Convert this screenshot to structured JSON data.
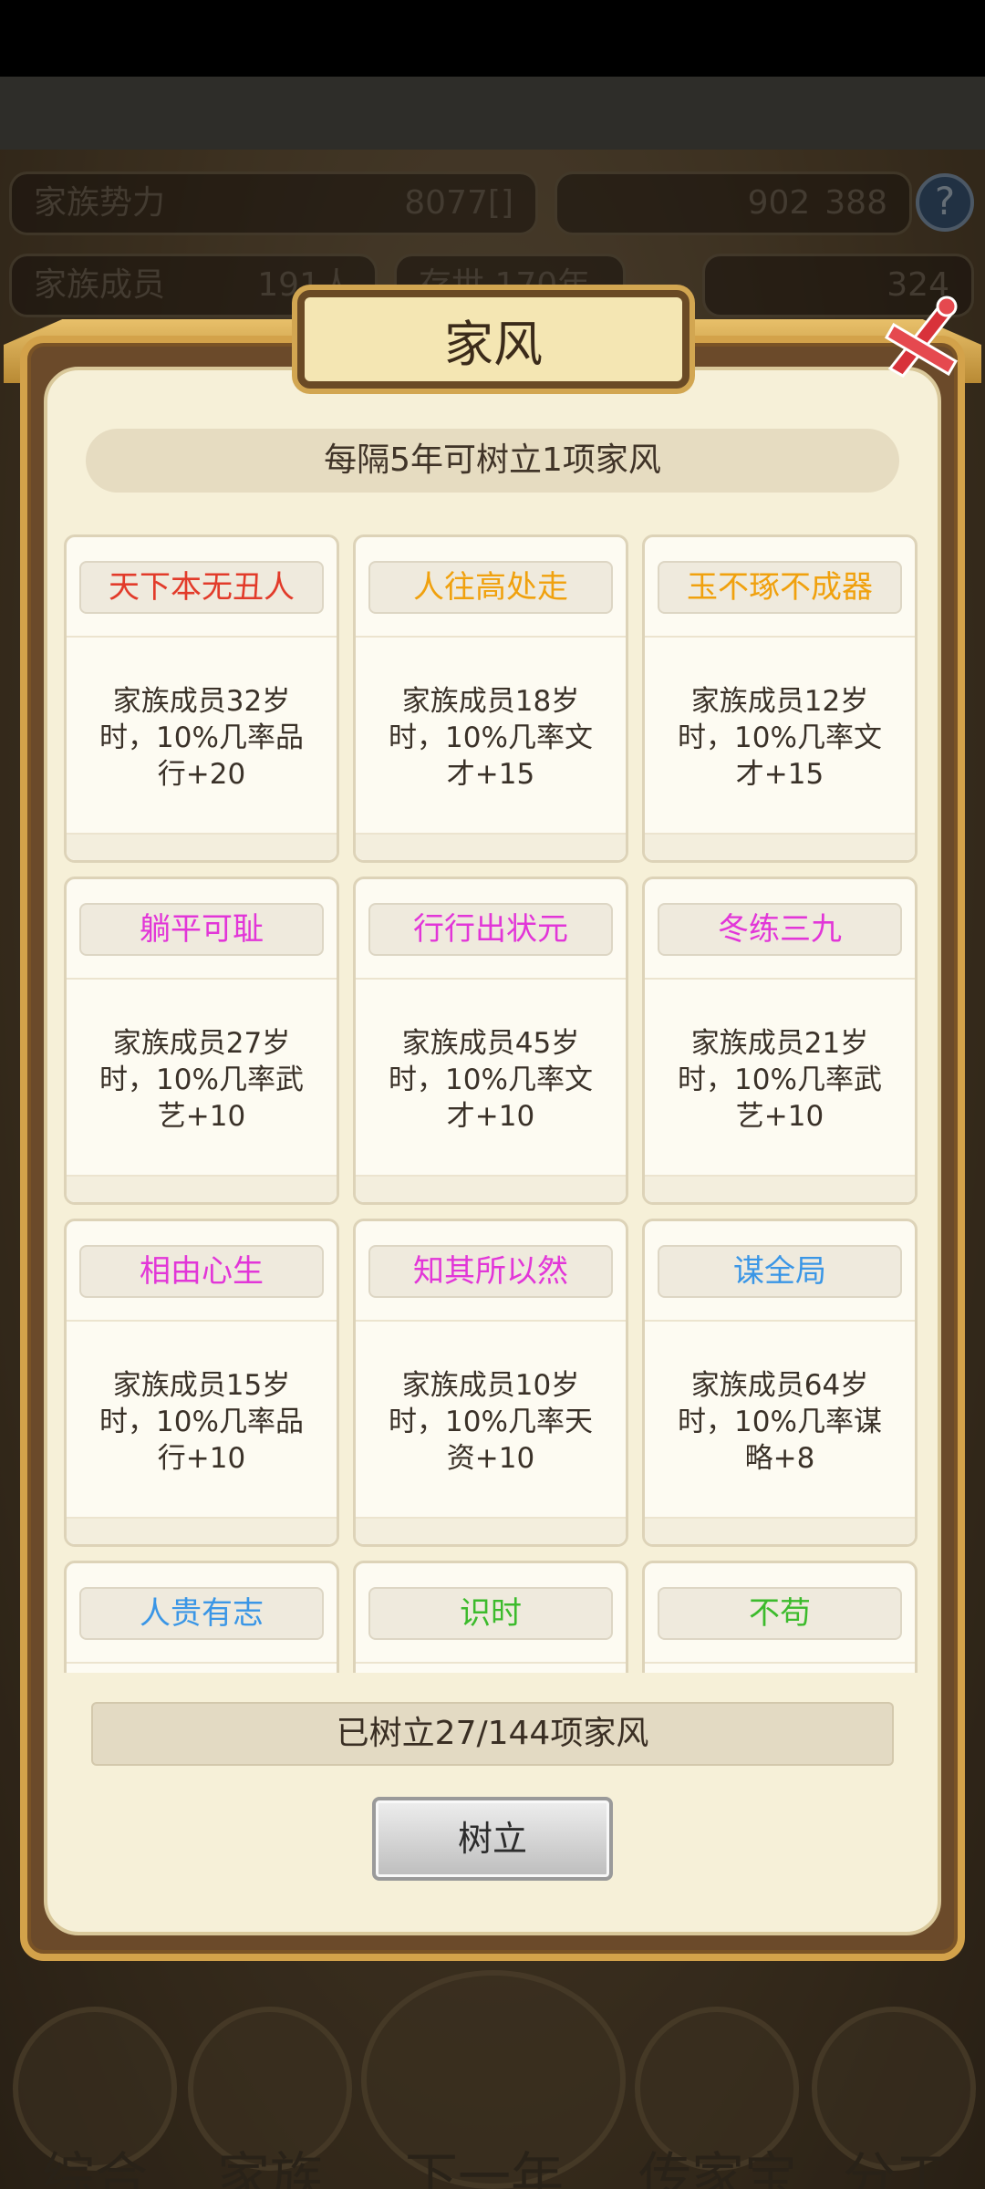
{
  "background": {
    "family_power_label": "家族势力",
    "family_power_value": "8077[",
    "family_power_suffix": "]",
    "currency_a": "902",
    "currency_b": "388",
    "members_label": "家族成员",
    "members_value": "191人",
    "lineage_label": "存世 170年",
    "gold_value": "324",
    "nav": [
      "综合",
      "家族",
      "下一年",
      "传家宝",
      "分工"
    ]
  },
  "dialog": {
    "title": "家风",
    "info": "每隔5年可树立1项家风",
    "cards": [
      {
        "name": "天下本无丑人",
        "color": "#e23b2a",
        "desc": "家族成员32岁时，10%几率品行+20"
      },
      {
        "name": "人往高处走",
        "color": "#f0a10e",
        "desc": "家族成员18岁时，10%几率文才+15"
      },
      {
        "name": "玉不琢不成器",
        "color": "#f0a10e",
        "desc": "家族成员12岁时，10%几率文才+15"
      },
      {
        "name": "躺平可耻",
        "color": "#e236d8",
        "desc": "家族成员27岁时，10%几率武艺+10"
      },
      {
        "name": "行行出状元",
        "color": "#e236d8",
        "desc": "家族成员45岁时，10%几率文才+10"
      },
      {
        "name": "冬练三九",
        "color": "#e236d8",
        "desc": "家族成员21岁时，10%几率武艺+10"
      },
      {
        "name": "相由心生",
        "color": "#e236d8",
        "desc": "家族成员15岁时，10%几率品行+10"
      },
      {
        "name": "知其所以然",
        "color": "#e236d8",
        "desc": "家族成员10岁时，10%几率天资+10"
      },
      {
        "name": "谋全局",
        "color": "#3a96e6",
        "desc": "家族成员64岁时，10%几率谋略+8"
      },
      {
        "name": "人贵有志",
        "color": "#3a96e6",
        "desc": ""
      },
      {
        "name": "识时",
        "color": "#3cbb2c",
        "desc": ""
      },
      {
        "name": "不苟",
        "color": "#3cbb2c",
        "desc": ""
      }
    ],
    "progress": "已树立27/144项家风",
    "confirm_label": "树立"
  }
}
